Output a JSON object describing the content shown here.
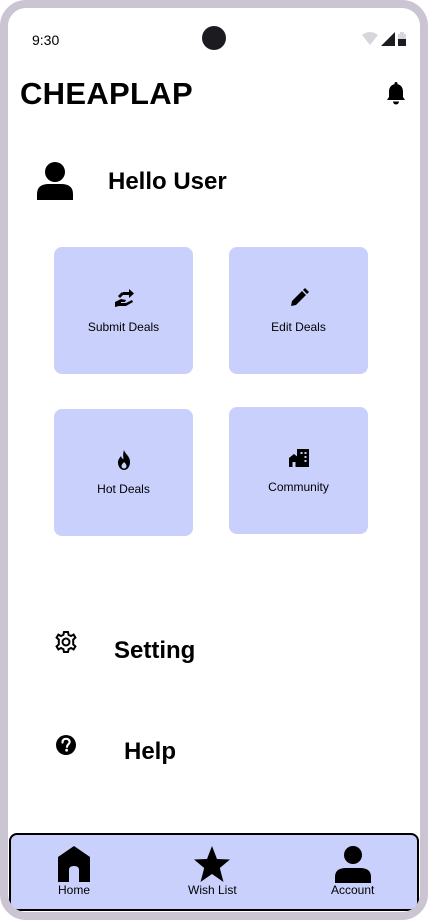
{
  "status_bar": {
    "time": "9:30"
  },
  "header": {
    "title": "CHEAPLAP",
    "notification_icon": "bell-icon"
  },
  "greeting": {
    "text": "Hello User",
    "avatar_icon": "person-icon"
  },
  "tiles": [
    {
      "label": "Submit Deals",
      "icon": "hand-deal-icon"
    },
    {
      "label": "Edit Deals",
      "icon": "pencil-icon"
    },
    {
      "label": "Hot Deals",
      "icon": "fire-icon"
    },
    {
      "label": "Community",
      "icon": "buildings-icon"
    }
  ],
  "menu": [
    {
      "label": "Setting",
      "icon": "gear-icon"
    },
    {
      "label": "Help",
      "icon": "help-circle-icon"
    }
  ],
  "bottom_nav": [
    {
      "label": "Home",
      "icon": "home-icon"
    },
    {
      "label": "Wish List",
      "icon": "star-icon"
    },
    {
      "label": "Account",
      "icon": "person-icon"
    }
  ],
  "colors": {
    "tile_bg": "#c9d0fb",
    "frame": "#cac4d3",
    "text": "#000000"
  }
}
